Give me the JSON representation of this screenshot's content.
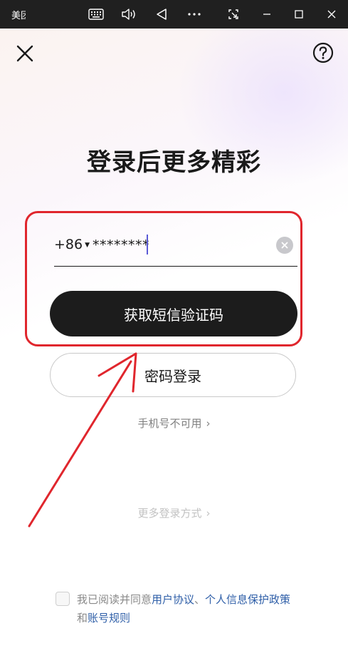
{
  "window": {
    "title": "美团",
    "buttons": [
      "keyboard-icon",
      "volume-icon",
      "back-triangle-icon",
      "more-icon",
      "screenshot-icon",
      "minimize-icon",
      "maximize-icon",
      "close-icon"
    ]
  },
  "header": {
    "close_icon": "close-icon",
    "help_icon": "help-circle-icon"
  },
  "headline": "登录后更多精彩",
  "login": {
    "country_code": "+86",
    "phone_value": "********",
    "sms_button": "获取短信验证码",
    "password_button": "密码登录",
    "phone_unavailable": "手机号不可用",
    "more_methods": "更多登录方式"
  },
  "agreement": {
    "prefix": "我已阅读并同意",
    "user_agreement": "用户协议",
    "separator": "、",
    "privacy_policy": "个人信息保护政策",
    "and": "和",
    "account_rules": "账号规则"
  },
  "colors": {
    "annotation_red": "#e0262d",
    "primary_button": "#1c1c1c",
    "link_blue": "#2f5fa8",
    "titlebar": "#202020"
  }
}
